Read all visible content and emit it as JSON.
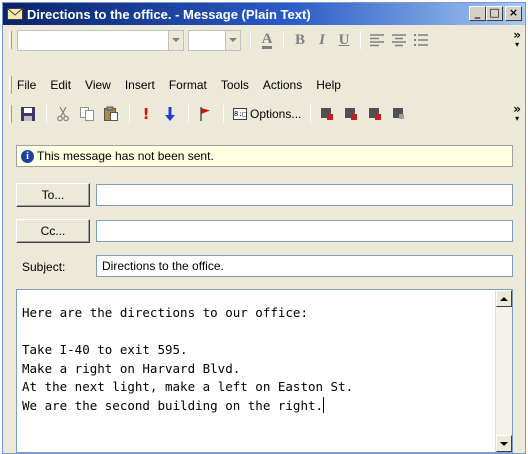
{
  "window": {
    "title": "Directions to the office. - Message (Plain Text)",
    "controls": {
      "minimize": "_",
      "maximize": "□",
      "close": "×"
    }
  },
  "format_toolbar": {
    "bold": "B",
    "italic": "I",
    "underline": "U",
    "font_color": "A",
    "more": "»"
  },
  "menu": {
    "items": [
      {
        "label": "File"
      },
      {
        "label": "Edit"
      },
      {
        "label": "View"
      },
      {
        "label": "Insert"
      },
      {
        "label": "Format"
      },
      {
        "label": "Tools"
      },
      {
        "label": "Actions"
      },
      {
        "label": "Help"
      }
    ]
  },
  "standard_toolbar": {
    "options_label": "Options...",
    "options_box": "8:□",
    "importance_high": "!",
    "more": "»"
  },
  "infobar": {
    "message": "This message has not been sent.",
    "icon": "i"
  },
  "to": {
    "label": "To...",
    "value": ""
  },
  "cc": {
    "label": "Cc...",
    "value": ""
  },
  "subject": {
    "label": "Subject:",
    "value": "Directions to the office."
  },
  "body": {
    "text": "Here are the directions to our office:\n\nTake I-40 to exit 595.\nMake a right on Harvard Blvd.\nAt the next light, make a left on Easton St.\nWe are the second building on the right."
  },
  "colors": {
    "title_start": "#0a246a",
    "title_end": "#a6caf0",
    "face": "#ece9d8",
    "infobar": "#ffffe1",
    "importance_high": "#ff0000",
    "importance_low": "#0000ff"
  }
}
